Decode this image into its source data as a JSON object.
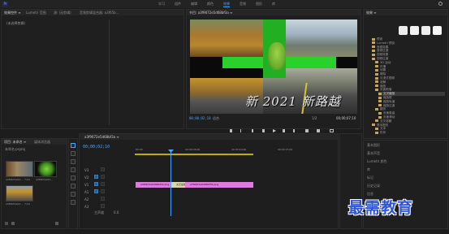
{
  "app": {
    "logo": "Pr"
  },
  "workspace_tabs": [
    "学习",
    "组件",
    "编辑",
    "颜色",
    "效果",
    "音频",
    "图形",
    "库"
  ],
  "workspace_active": 4,
  "source_panel": {
    "tabs": [
      "效果控件 ≡",
      "Lumetri 范围",
      "源: (无剪辑)",
      "音频剪辑混合器: a3f65b..."
    ],
    "empty_label": "(未选择剪辑)"
  },
  "program_panel": {
    "tab": "节目: a3f9672e5d68bf3a ≡",
    "timecode_current": "00;00;02;10",
    "fit": "适合",
    "quality": "1/2",
    "timecode_duration": "00;00;07;10",
    "video_text": "新 2021 新路越"
  },
  "effects_panel": {
    "tab": "效果 ≡",
    "tree": [
      "预设",
      "Lumetri 预设",
      "音频效果",
      "音频过渡",
      "视频效果",
      "视频过渡",
      "3D 运动",
      "内滑",
      "划像",
      "擦除",
      "沉浸式视频",
      "溶解",
      "缩放",
      "页面剥落",
      "交叉缩放",
      "缩放框",
      "缩放轨道",
      "缩放过渡",
      "翻页",
      "页面卷曲",
      "页面滑动",
      "交叉溶解",
      "基本图形",
      "文本",
      "形状"
    ],
    "selected_index": 14
  },
  "project_panel": {
    "tabs": [
      "项目: 未命名 ≡",
      "媒体浏览器"
    ],
    "project_name": "未命名.prproj",
    "items": [
      {
        "name": "a3f9672e5d...",
        "duration": "7;10"
      },
      {
        "name": "a3f9672e5d...",
        "duration": "7;10"
      },
      {
        "name": "a3f9672e5d...",
        "duration": "7;10"
      }
    ]
  },
  "timeline": {
    "tab": "a3f9672e5d68bf3a ≡",
    "timecode": "00;00;02;10",
    "ruler": [
      "00;00",
      "00;00;05;00",
      "00;00;10;00",
      "00;00;15;00"
    ],
    "tracks": [
      "V3",
      "V2",
      "V1",
      "A1",
      "A2",
      "A3"
    ],
    "master": "主声道",
    "master_value": "0.0",
    "clips": [
      {
        "label": "a3f9672e5d68bf3a.png"
      },
      {
        "label": "交叉缩放"
      },
      {
        "label": "a3f9672e5d68bf3a.png"
      }
    ]
  },
  "right_panel_items": [
    "基本图形",
    "基本声音",
    "Lumetri 颜色",
    "库",
    "标记",
    "历史记录",
    "信息"
  ],
  "watermark": "最需教育",
  "colors": {
    "accent": "#4aa3ff",
    "clip": "#e278e2",
    "transition": "#d9d6a8",
    "watermark": "#2f54d6"
  }
}
